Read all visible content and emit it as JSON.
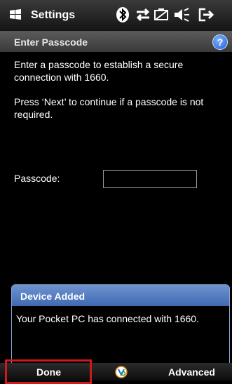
{
  "status_bar": {
    "title": "Settings"
  },
  "subheader": {
    "title": "Enter Passcode",
    "help_glyph": "?"
  },
  "content": {
    "paragraph1": "Enter a passcode to establish a secure connection with 1660.",
    "paragraph2": "Press ‘Next’ to continue if a passcode is not required.",
    "passcode_label": "Passcode:",
    "passcode_value": ""
  },
  "popup": {
    "title": "Device Added",
    "message": "Your Pocket PC has connected with 1660."
  },
  "softkeys": {
    "left": "Done",
    "right": "Advanced"
  },
  "icons": [
    "windows-logo-icon",
    "bluetooth-icon",
    "connectivity-icon",
    "battery-icon",
    "volume-icon",
    "exit-icon",
    "help-icon",
    "keyboard-icon"
  ],
  "colors": {
    "popup_header": "#4f78be",
    "highlight": "#d01818",
    "help": "#1e5fd6"
  }
}
